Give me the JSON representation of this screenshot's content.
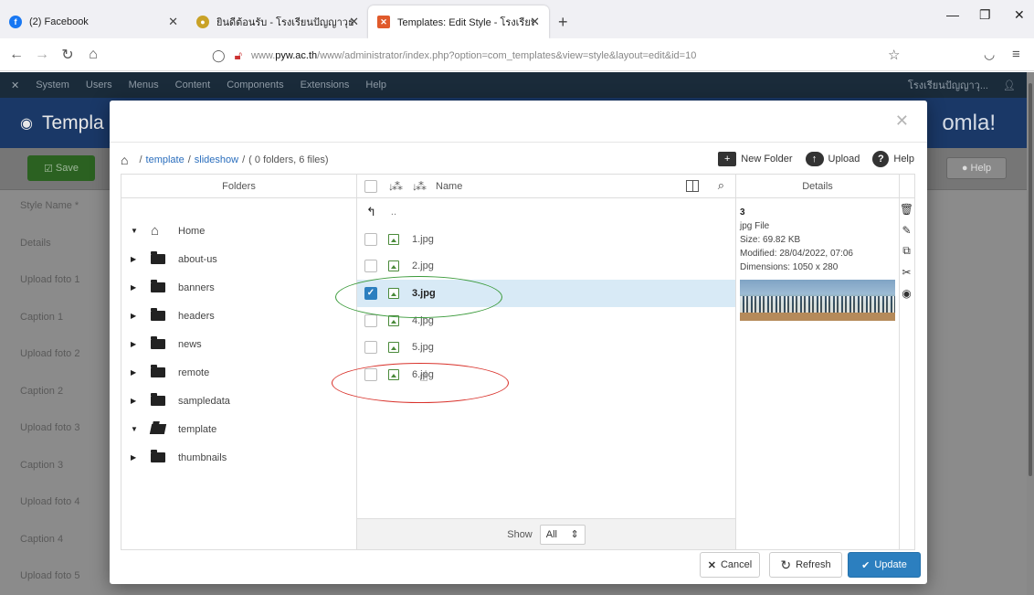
{
  "browser": {
    "tabs": [
      {
        "title": "(2) Facebook",
        "favicon": "facebook-icon",
        "color": "#1877f2"
      },
      {
        "title": "ยินดีต้อนรับ - โรงเรียนปัญญาวุธ",
        "favicon": "school-icon",
        "color": "#c9a227"
      },
      {
        "title": "Templates: Edit Style - โรงเรียนป",
        "favicon": "joomla-icon",
        "color": "#e05a2b"
      }
    ],
    "url_prefix": "www.",
    "url_host": "pyw.ac.th",
    "url_rest": "/www/administrator/index.php?option=com_templates&view=style&layout=edit&id=10"
  },
  "admin": {
    "menu": [
      "System",
      "Users",
      "Menus",
      "Content",
      "Components",
      "Extensions",
      "Help"
    ],
    "site_name": "โรงเรียนปัญญาวุ... ",
    "page_title": "Templa",
    "brand": "omla!",
    "save_label": "Save",
    "help_label": "Help",
    "form_labels": [
      "Style Name *",
      "Details",
      "Upload foto 1",
      "Caption 1",
      "Upload foto 2",
      "Caption 2",
      "Upload foto 3",
      "Caption 3",
      "Upload foto 4",
      "Caption 4",
      "Upload foto 5"
    ]
  },
  "modal": {
    "breadcrumb": {
      "parts": [
        "template",
        "slideshow"
      ],
      "summary": "( 0 folders, 6 files)"
    },
    "actions": {
      "new_folder": "New Folder",
      "upload": "Upload",
      "help": "Help"
    },
    "folders_header": "Folders",
    "folders": [
      {
        "name": "Home",
        "expanded": true,
        "icon": "home-icon"
      },
      {
        "name": "about-us",
        "expanded": false
      },
      {
        "name": "banners",
        "expanded": false
      },
      {
        "name": "headers",
        "expanded": false
      },
      {
        "name": "news",
        "expanded": false
      },
      {
        "name": "remote",
        "expanded": false
      },
      {
        "name": "sampledata",
        "expanded": false
      },
      {
        "name": "template",
        "expanded": true
      },
      {
        "name": "thumbnails",
        "expanded": false
      }
    ],
    "files_header": "Name",
    "parent_label": "..",
    "files": [
      {
        "name": "1.jpg",
        "checked": false
      },
      {
        "name": "2.jpg",
        "checked": false
      },
      {
        "name": "3.jpg",
        "checked": true
      },
      {
        "name": "4.jpg",
        "checked": false
      },
      {
        "name": "5.jpg",
        "checked": false
      },
      {
        "name": "6.jpg",
        "checked": false
      }
    ],
    "show_label": "Show",
    "show_value": "All",
    "details_header": "Details",
    "details": {
      "name": "3",
      "type": "jpg File",
      "size": "Size: 69.82 KB",
      "modified": "Modified: 28/04/2022, 07:06",
      "dimensions": "Dimensions: 1050 x 280"
    },
    "buttons": {
      "cancel": "Cancel",
      "refresh": "Refresh",
      "update": "Update"
    }
  }
}
